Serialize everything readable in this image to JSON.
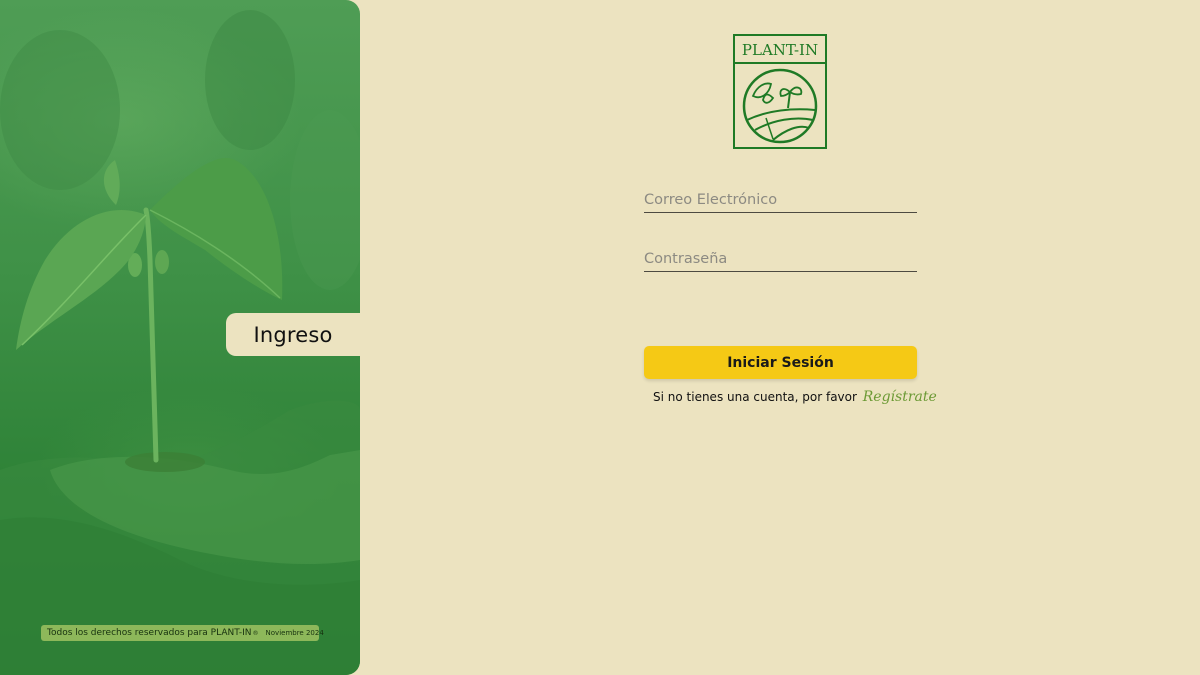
{
  "hero": {
    "tab_label": "Ingreso",
    "copyright_text": "Todos los derechos reservados para PLANT-IN",
    "registered_mark": "®",
    "copyright_date": "Noviembre 2024"
  },
  "logo": {
    "brand_name": "PLANT-IN"
  },
  "form": {
    "email_placeholder": "Correo Electrónico",
    "email_value": "",
    "password_placeholder": "Contraseña",
    "password_value": "",
    "submit_label": "Iniciar Sesión",
    "register_prompt": "Si no tienes una cuenta, por favor",
    "register_link": "Regístrate"
  },
  "colors": {
    "background": "#ece3c0",
    "hero_green": "#3f9147",
    "brand_green": "#1f7a25",
    "button_yellow": "#f5c915",
    "link_green": "#6c9a35",
    "badge_green": "#8db85a"
  },
  "icons": {
    "logo_emblem": "seedling-field-emblem-icon"
  }
}
